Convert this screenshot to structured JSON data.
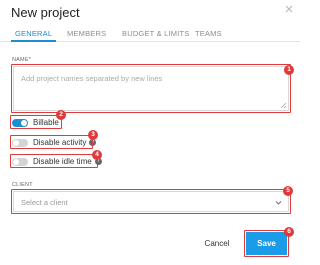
{
  "dialog": {
    "title": "New project",
    "close_icon": "close-icon"
  },
  "tabs": [
    {
      "label": "GENERAL",
      "active": true
    },
    {
      "label": "MEMBERS",
      "active": false
    },
    {
      "label": "BUDGET & LIMITS",
      "active": false
    },
    {
      "label": "TEAMS",
      "active": false
    }
  ],
  "name_field": {
    "label": "NAME*",
    "placeholder": "Add project names separated by new lines",
    "value": ""
  },
  "toggles": {
    "billable": {
      "label": "Billable",
      "on": true
    },
    "disable_activity": {
      "label": "Disable activity",
      "on": false,
      "info_icon": "info-icon"
    },
    "disable_idle_time": {
      "label": "Disable idle time",
      "on": false,
      "info_icon": "info-icon"
    }
  },
  "client_field": {
    "label": "CLIENT",
    "placeholder": "Select a client",
    "icon": "chevron-down-icon"
  },
  "buttons": {
    "cancel": "Cancel",
    "save": "Save"
  },
  "annotations": [
    "1",
    "2",
    "3",
    "4",
    "5",
    "6"
  ],
  "colors": {
    "accent": "#1b8ed4",
    "save_button": "#1b9ce8",
    "annotation": "#e03a3a"
  }
}
